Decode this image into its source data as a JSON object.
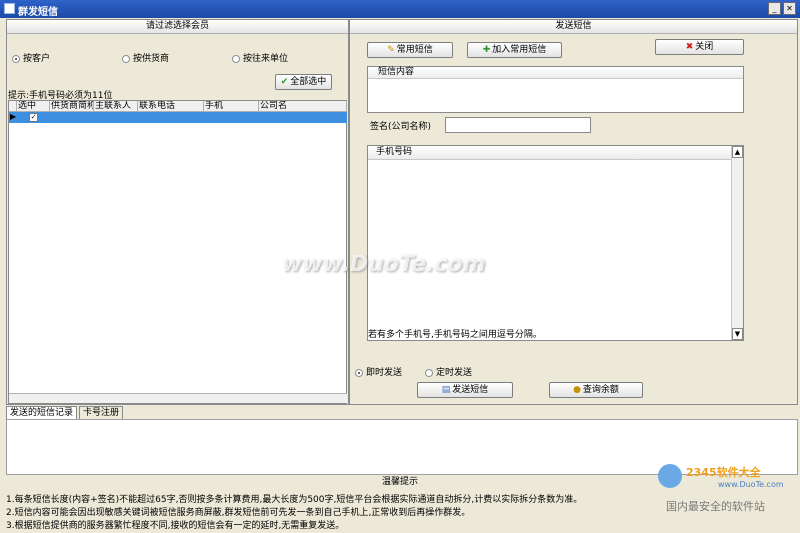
{
  "window": {
    "title": "群发短信"
  },
  "left_panel": {
    "header": "请过滤选择会员",
    "filter_options": [
      "按客户",
      "按供货商",
      "按往来单位"
    ],
    "selected_filter": 0,
    "select_all_label": "全部选中",
    "hint": "提示:手机号码必须为11位",
    "table_headers": [
      "选中",
      "供货商简称",
      "主联系人",
      "联系电话",
      "手机",
      "公司名"
    ],
    "row_selected_checked": "✓"
  },
  "right_panel": {
    "header": "发送短信",
    "common_sms_label": "常用短信",
    "add_common_sms_label": "加入常用短信",
    "close_label": "关闭",
    "sms_content_label": "短信内容",
    "signature_label": "签名(公司名称)",
    "signature_value": "",
    "phone_list_label": "手机号码",
    "phone_hint": "若有多个手机号,手机号码之间用逗号分隔。",
    "send_now_label": "即时发送",
    "schedule_label": "定时发送",
    "send_mode_selected": 0,
    "send_sms_label": "发送短信",
    "check_balance_label": "查询余额"
  },
  "bottom_tabs": [
    "发送的短信记录",
    "卡号注册"
  ],
  "notes": {
    "header": "温馨提示",
    "lines": [
      "1.每条短信长度(内容+签名)不能超过65字,否则按多条计算费用,最大长度为500字,短信平台会根据实际通道自动拆分,计费以实际拆分条数为准。",
      "2.短信内容可能会因出现敏感关键词被短信服务商屏蔽,群发短信前可先发一条到自己手机上,正常收到后再操作群发。",
      "3.根据短信提供商的服务器繁忙程度不同,接收的短信会有一定的延时,无需重复发送。"
    ]
  },
  "watermark": {
    "center": "www.DuoTe.com",
    "logo": "2345软件大全",
    "logo_url": "www.DuoTe.com",
    "logo_sub": "国内最安全的软件站"
  },
  "colors": {
    "title_bar": "#1b4aa6",
    "selected_row": "#3d8fe0"
  }
}
